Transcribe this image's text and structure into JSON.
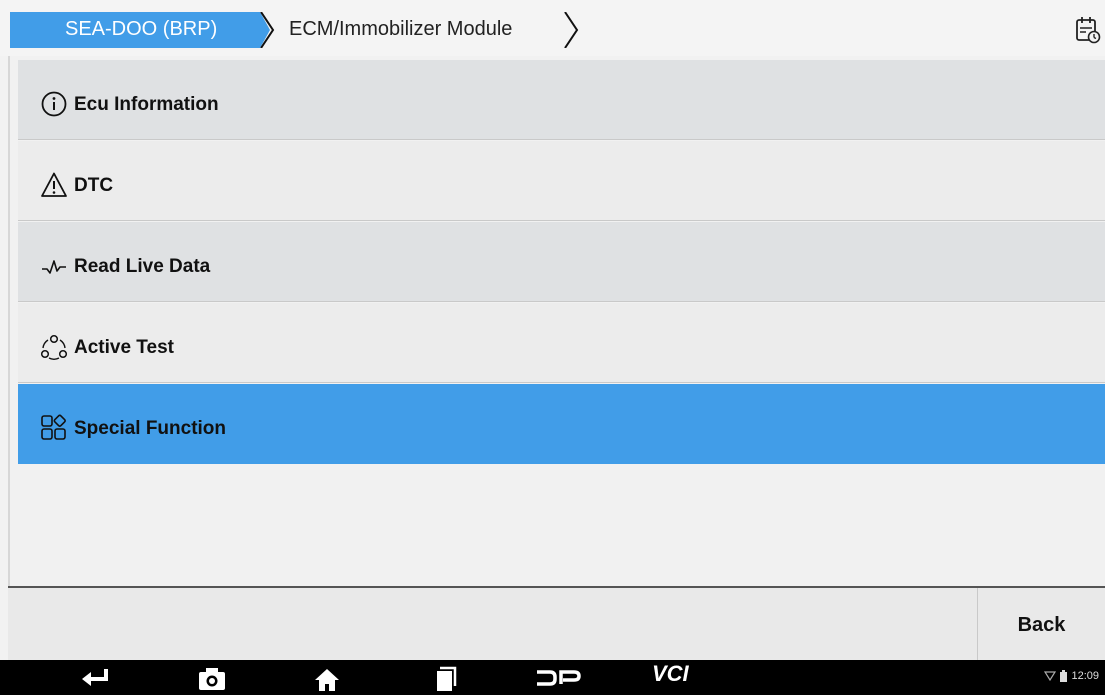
{
  "breadcrumb": {
    "items": [
      {
        "label": "SEA-DOO (BRP)"
      },
      {
        "label": "ECM/Immobilizer Module"
      }
    ]
  },
  "menu": {
    "items": [
      {
        "label": "Ecu Information",
        "icon": "info-icon"
      },
      {
        "label": "DTC",
        "icon": "warning-icon"
      },
      {
        "label": "Read Live Data",
        "icon": "waveform-icon"
      },
      {
        "label": "Active Test",
        "icon": "active-test-icon"
      },
      {
        "label": "Special Function",
        "icon": "grid-apps-icon",
        "selected": true
      }
    ]
  },
  "footer": {
    "back_label": "Back"
  },
  "system_bar": {
    "time": "12:09",
    "buttons": [
      "back-icon",
      "camera-icon",
      "home-icon",
      "recent-apps-icon",
      "dp-logo-icon",
      "vci-icon"
    ],
    "vci_label": "VCI"
  },
  "colors": {
    "accent": "#419de8",
    "breadcrumb_active": "#419de8"
  }
}
